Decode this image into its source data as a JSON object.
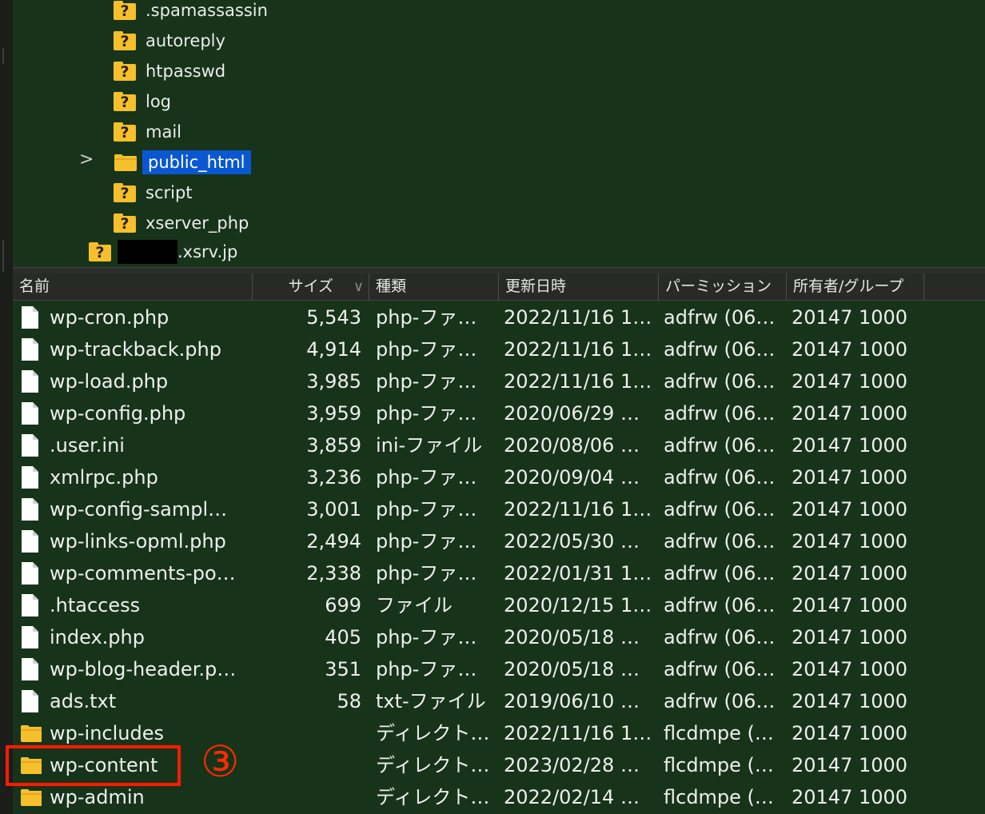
{
  "tree": {
    "items": [
      {
        "label": ".spamassassin"
      },
      {
        "label": "autoreply"
      },
      {
        "label": "htpasswd"
      },
      {
        "label": "log"
      },
      {
        "label": "mail"
      },
      {
        "label": "public_html"
      },
      {
        "label": "script"
      },
      {
        "label": "xserver_php"
      }
    ],
    "host_suffix": ".xsrv.jp",
    "unknown_glyph": "?",
    "expand_glyph": ">"
  },
  "columns": {
    "name": "名前",
    "size": "サイズ",
    "type": "種類",
    "modified": "更新日時",
    "permission": "パーミッション",
    "owner": "所有者/グループ",
    "sort_glyph": "∨"
  },
  "files": [
    {
      "kind": "file",
      "name": "wp-cron.php",
      "size": "5,543",
      "type": "php-ファ…",
      "modified": "2022/11/16 1…",
      "permission": "adfrw (06…",
      "owner": "20147 1000"
    },
    {
      "kind": "file",
      "name": "wp-trackback.php",
      "size": "4,914",
      "type": "php-ファ…",
      "modified": "2022/11/16 1…",
      "permission": "adfrw (06…",
      "owner": "20147 1000"
    },
    {
      "kind": "file",
      "name": "wp-load.php",
      "size": "3,985",
      "type": "php-ファ…",
      "modified": "2022/11/16 1…",
      "permission": "adfrw (06…",
      "owner": "20147 1000"
    },
    {
      "kind": "file",
      "name": "wp-config.php",
      "size": "3,959",
      "type": "php-ファ…",
      "modified": "2020/06/29 …",
      "permission": "adfrw (06…",
      "owner": "20147 1000"
    },
    {
      "kind": "file",
      "name": ".user.ini",
      "size": "3,859",
      "type": "ini-ファイル",
      "modified": "2020/08/06 …",
      "permission": "adfrw (06…",
      "owner": "20147 1000"
    },
    {
      "kind": "file",
      "name": "xmlrpc.php",
      "size": "3,236",
      "type": "php-ファ…",
      "modified": "2020/09/04 …",
      "permission": "adfrw (06…",
      "owner": "20147 1000"
    },
    {
      "kind": "file",
      "name": "wp-config-sampl…",
      "size": "3,001",
      "type": "php-ファ…",
      "modified": "2022/11/16 1…",
      "permission": "adfrw (06…",
      "owner": "20147 1000"
    },
    {
      "kind": "file",
      "name": "wp-links-opml.php",
      "size": "2,494",
      "type": "php-ファ…",
      "modified": "2022/05/30 …",
      "permission": "adfrw (06…",
      "owner": "20147 1000"
    },
    {
      "kind": "file",
      "name": "wp-comments-po…",
      "size": "2,338",
      "type": "php-ファ…",
      "modified": "2022/01/31 1…",
      "permission": "adfrw (06…",
      "owner": "20147 1000"
    },
    {
      "kind": "file",
      "name": ".htaccess",
      "size": "699",
      "type": "ファイル",
      "modified": "2020/12/15 1…",
      "permission": "adfrw (06…",
      "owner": "20147 1000"
    },
    {
      "kind": "file",
      "name": "index.php",
      "size": "405",
      "type": "php-ファ…",
      "modified": "2020/05/18 …",
      "permission": "adfrw (06…",
      "owner": "20147 1000"
    },
    {
      "kind": "file",
      "name": "wp-blog-header.p…",
      "size": "351",
      "type": "php-ファ…",
      "modified": "2020/05/18 …",
      "permission": "adfrw (06…",
      "owner": "20147 1000"
    },
    {
      "kind": "file",
      "name": "ads.txt",
      "size": "58",
      "type": "txt-ファイル",
      "modified": "2019/06/10 …",
      "permission": "adfrw (06…",
      "owner": "20147 1000"
    },
    {
      "kind": "folder",
      "name": "wp-includes",
      "size": "",
      "type": "ディレクト…",
      "modified": "2022/11/16 1…",
      "permission": "flcdmpe (…",
      "owner": "20147 1000"
    },
    {
      "kind": "folder",
      "name": "wp-content",
      "size": "",
      "type": "ディレクト…",
      "modified": "2023/02/28 …",
      "permission": "flcdmpe (…",
      "owner": "20147 1000"
    },
    {
      "kind": "folder",
      "name": "wp-admin",
      "size": "",
      "type": "ディレクト…",
      "modified": "2022/02/14 …",
      "permission": "flcdmpe (…",
      "owner": "20147 1000"
    }
  ],
  "annotation": {
    "number": "③",
    "color": "#ff2a00"
  },
  "colors": {
    "background": "#17341a",
    "selection": "#0a58d1",
    "folder": "#f6c02c",
    "highlight": "#ff1a00"
  }
}
